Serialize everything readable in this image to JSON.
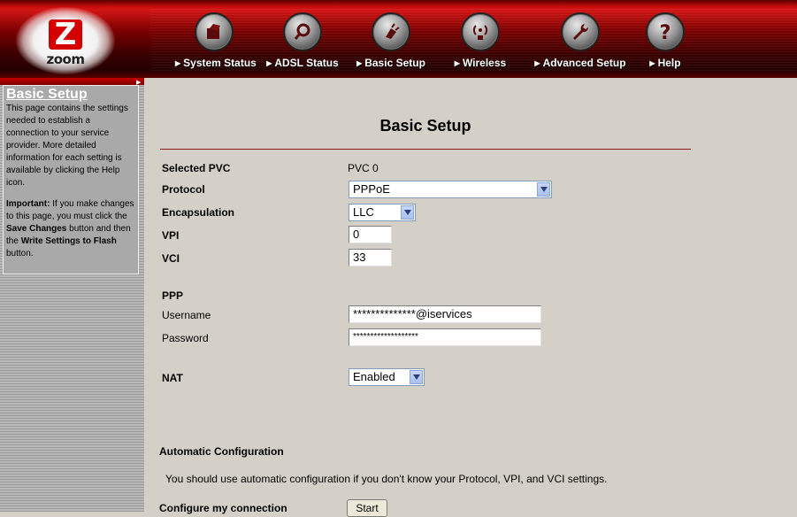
{
  "brand": {
    "logo_letter": "Z",
    "logo_word": "zoom",
    "accent": "#c40000"
  },
  "nav": [
    {
      "label": "System Status",
      "icon": "file-open-icon"
    },
    {
      "label": "ADSL Status",
      "icon": "magnifier-icon"
    },
    {
      "label": "Basic Setup",
      "icon": "plug-icon"
    },
    {
      "label": "Wireless",
      "icon": "wireless-antenna-icon"
    },
    {
      "label": "Advanced Setup",
      "icon": "wrench-icon"
    },
    {
      "label": "Help",
      "icon": "question-icon"
    }
  ],
  "sidebar": {
    "title": "Basic Setup",
    "para1": "This page contains the settings needed to establish a connection to your service provider. More detailed information for each setting is available by clicking the Help icon.",
    "important_label": "Important:",
    "para2_a": " If you make changes to this page, you must click the ",
    "save_changes": "Save Changes",
    "para2_b": " button and then the ",
    "write_flash": "Write Settings to Flash",
    "para2_c": " button."
  },
  "main": {
    "title": "Basic Setup",
    "selected_pvc_label": "Selected PVC",
    "selected_pvc_value": "PVC 0",
    "protocol_label": "Protocol",
    "protocol_value": "PPPoE",
    "encapsulation_label": "Encapsulation",
    "encapsulation_value": "LLC",
    "vpi_label": "VPI",
    "vpi_value": "0",
    "vci_label": "VCI",
    "vci_value": "33",
    "ppp_label": "PPP",
    "username_label": "Username",
    "username_value": "**************@iservices",
    "password_label": "Password",
    "password_value": "*******************",
    "nat_label": "NAT",
    "nat_value": "Enabled",
    "auto_config_label": "Automatic Configuration",
    "auto_config_text": "You should use automatic configuration if you don't know your Protocol, VPI, and VCI settings.",
    "configure_label": "Configure my connection",
    "start_button": "Start"
  }
}
